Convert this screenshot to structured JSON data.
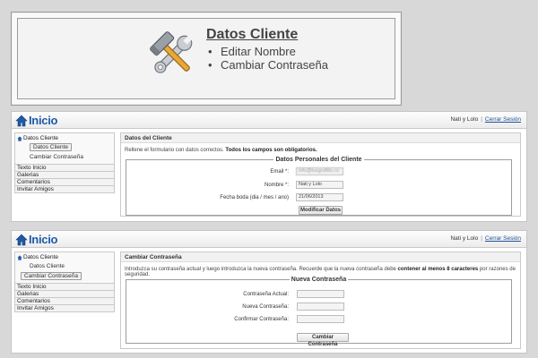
{
  "mockup": {
    "title": "Datos Cliente",
    "items": [
      {
        "label": "Editar Nombre"
      },
      {
        "label": "Cambiar Contraseña"
      }
    ],
    "icon": "tools-icon"
  },
  "screen1": {
    "logo_text": "Inicio",
    "user_name": "Nati y Lolo",
    "separator": "|",
    "logout_label": "Cerrar Sesión",
    "sidebar": {
      "group_label": "Datos Cliente",
      "sub_items": [
        {
          "label": "Datos Cliente",
          "active": true
        },
        {
          "label": "Cambiar Contraseña",
          "active": false
        }
      ],
      "items": [
        {
          "label": "Texto Inicio"
        },
        {
          "label": "Galerias"
        },
        {
          "label": "Comentarios"
        },
        {
          "label": "Invitar Amigos"
        }
      ]
    },
    "card_title": "Datos del Cliente",
    "intro_text": "Rellene el formulario con datos correctos. ",
    "intro_bold": "Todos los campos son obligatorios.",
    "legend": "Datos Personales del Cliente",
    "fields": {
      "email_label": "Email *:",
      "email_value": "info@tusgrafitis.co",
      "name_label": "Nombre *:",
      "name_value": "Nati y Lolo",
      "date_label": "Fecha boda (dia / mes / ano)",
      "date_value": "21/06/2013"
    },
    "submit_label": "Modificar Datos"
  },
  "screen2": {
    "logo_text": "Inicio",
    "user_name": "Nati y Lolo",
    "separator": "|",
    "logout_label": "Cerrar Sesión",
    "sidebar": {
      "group_label": "Datos Cliente",
      "sub_items": [
        {
          "label": "Datos Cliente",
          "active": false
        },
        {
          "label": "Cambiar Contraseña",
          "active": true
        }
      ],
      "items": [
        {
          "label": "Texto Inicio"
        },
        {
          "label": "Galerias"
        },
        {
          "label": "Comentarios"
        },
        {
          "label": "Invitar Amigos"
        }
      ]
    },
    "card_title": "Cambiar Contraseña",
    "intro_text": "Introduzca su contraseña actual y luego introduzca la nueva contraseña. Recuerde que la nueva contraseña debe ",
    "intro_bold": "contener al menos 8 caracteres",
    "intro_tail": " por razones de seguridad.",
    "legend": "Nueva Contraseña",
    "fields": {
      "current_label": "Contraseña Actual:",
      "new_label": "Nueva Contraseña:",
      "confirm_label": "Confirmar Contraseña:"
    },
    "submit_label": "Cambiar Contraseña"
  },
  "colors": {
    "logo_blue": "#1e5aa8",
    "link_blue": "#1f4f97",
    "page_bg": "#d8d8d8"
  }
}
